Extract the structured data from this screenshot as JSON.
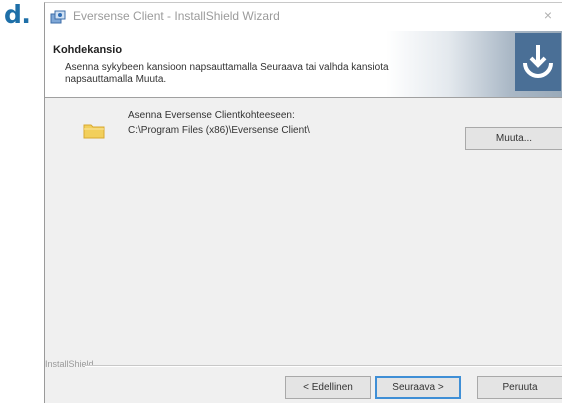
{
  "step_label": "d.",
  "window": {
    "title": "Eversense Client - InstallShield Wizard",
    "close_glyph": "×",
    "icon": "installer-icon"
  },
  "banner": {
    "title": "Kohdekansio",
    "description": "Asenna sykybeen kansioon napsauttamalla Seuraava tai valhda kansiota napsauttamalla Muuta.",
    "logo": "installshield-logo"
  },
  "body": {
    "folder_icon": "folder-icon",
    "destination_label": "Asenna Eversense Clientkohteeseen:",
    "destination_path": "C:\\Program Files (x86)\\Eversense Client\\",
    "change_button": "Muuta..."
  },
  "footer": {
    "brand": "InstallShield",
    "back_button": "< Edellinen",
    "next_button": "Seuraava >",
    "cancel_button": "Peruuta"
  }
}
